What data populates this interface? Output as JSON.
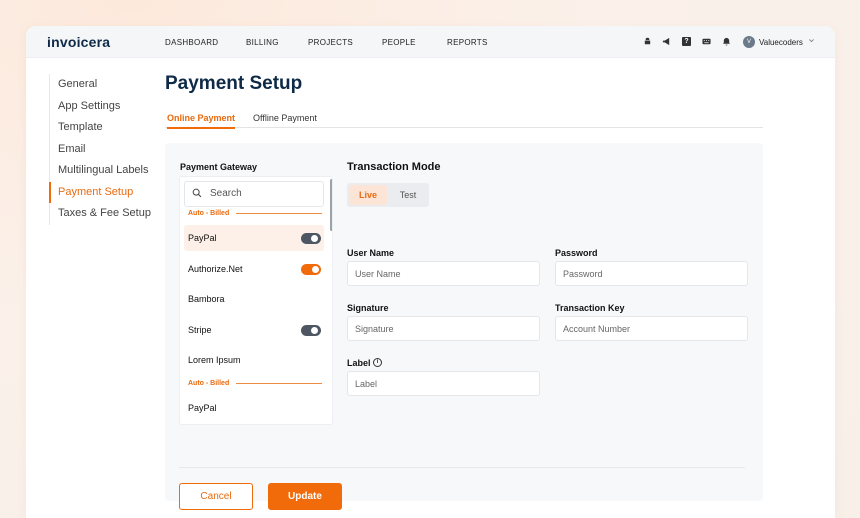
{
  "app": {
    "logo": "invoicera"
  },
  "topnav": {
    "items": [
      "DASHBOARD",
      "BILLING",
      "PROJECTS",
      "PEOPLE",
      "REPORTS"
    ],
    "icons": [
      "android-icon",
      "megaphone-icon",
      "help-icon",
      "keyboard-icon",
      "bell-icon"
    ],
    "help_glyph": "?",
    "user": {
      "initials": "V",
      "name": "Valuecoders"
    }
  },
  "sidebar": {
    "items": [
      {
        "label": "General"
      },
      {
        "label": "App Settings"
      },
      {
        "label": "Template"
      },
      {
        "label": "Email"
      },
      {
        "label": "Multilingual Labels"
      },
      {
        "label": "Payment Setup",
        "active": true
      },
      {
        "label": "Taxes & Fee Setup"
      }
    ]
  },
  "main": {
    "title": "Payment Setup",
    "tabs": [
      {
        "label": "Online Payment",
        "active": true
      },
      {
        "label": "Offline Payment"
      }
    ]
  },
  "gateway": {
    "title": "Payment Gateway",
    "search_placeholder": "Search",
    "sections": [
      "Auto - Billed",
      "Auto - Billed"
    ],
    "items": [
      {
        "label": "PayPal",
        "toggle": "off",
        "selected": true
      },
      {
        "label": "Authorize.Net",
        "toggle": "on"
      },
      {
        "label": "Bambora"
      },
      {
        "label": "Stripe",
        "toggle": "off"
      },
      {
        "label": "Lorem Ipsum"
      },
      {
        "label": "PayPal"
      }
    ]
  },
  "transaction": {
    "title": "Transaction Mode",
    "modes": [
      "Live",
      "Test"
    ],
    "selected_mode": "Live"
  },
  "form": {
    "user_name": {
      "label": "User Name",
      "placeholder": "User Name"
    },
    "password": {
      "label": "Password",
      "placeholder": "Password"
    },
    "signature": {
      "label": "Signature",
      "placeholder": "Signature"
    },
    "transaction_key": {
      "label": "Transaction Key",
      "placeholder": "Account Number"
    },
    "label_field": {
      "label": "Label",
      "placeholder": "Label"
    },
    "info_glyph": "i"
  },
  "actions": {
    "cancel": "Cancel",
    "update": "Update"
  },
  "colors": {
    "accent": "#f26b0a",
    "navy": "#0e2a47"
  }
}
